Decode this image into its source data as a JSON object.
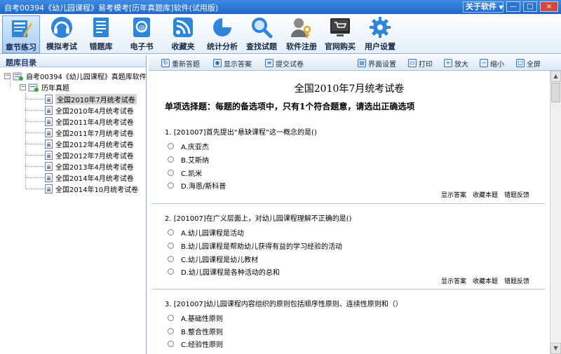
{
  "window": {
    "title": "自考00394《幼儿园课程》易考模考[历年真题库]软件(试用版)",
    "about_label": "关于软件",
    "min": "—",
    "restore": "□",
    "close": "×"
  },
  "toolbar": [
    {
      "label": "章节练习",
      "icon": "pencil-book-icon"
    },
    {
      "label": "模拟考试",
      "icon": "headset-icon"
    },
    {
      "label": "错题库",
      "icon": "notebook-icon"
    },
    {
      "label": "电子书",
      "icon": "ebook-icon"
    },
    {
      "label": "收藏夹",
      "icon": "rss-icon"
    },
    {
      "label": "统计分析",
      "icon": "pie-chart-icon"
    },
    {
      "label": "查找试题",
      "icon": "magnifier-icon"
    },
    {
      "label": "软件注册",
      "icon": "user-key-icon"
    },
    {
      "label": "官网购买",
      "icon": "cart-icon"
    },
    {
      "label": "用户设置",
      "icon": "gear-icon"
    }
  ],
  "sidebar": {
    "header": "题库目录",
    "root": "自考00394《幼儿园课程》真题库软件",
    "folder": "历年真题",
    "items": [
      "全国2010年7月统考试卷",
      "全国2010年4月统考试卷",
      "全国2011年4月统考试卷",
      "全国2011年7月统考试卷",
      "全国2012年4月统考试卷",
      "全国2012年7月统考试卷",
      "全国2013年4月统考试卷",
      "全国2014年4月统考试卷",
      "全国2014年10月统考试卷"
    ]
  },
  "rtoolbar": {
    "reset": "重新答题",
    "show": "显示答案",
    "submit": "提交试卷",
    "interface": "界面设置",
    "print": "打印",
    "zoom_in": "放大",
    "zoom_out": "缩小",
    "fullscreen": "全屏"
  },
  "paper": {
    "title": "全国2010年7月统考试卷",
    "section": "单项选择题：每题的备选项中，只有1个符合题意，请选出正确选项"
  },
  "actions": {
    "show": "显示答案",
    "fav": "收藏本题",
    "report": "错题反馈"
  },
  "questions": [
    {
      "text": "1. [201007]首先提出“悬缺课程”这一概念的是()",
      "options": [
        "A.庆亚杰",
        "B.艾斯纳",
        "C.凯米",
        "D.海恩/斯科普"
      ]
    },
    {
      "text": "2. [201007]在广义层面上，对幼儿园课程理解不正确的是()",
      "options": [
        "A.幼儿园课程是活动",
        "B.幼儿园课程是帮助幼儿获得有益的学习经验的活动",
        "C.幼儿园课程是幼儿教材",
        "D.幼儿园课程是各种活动的总和"
      ]
    },
    {
      "text": "3. [201007]幼儿园课程内容组织的原则包括顺序性原则、连续性原则和（）",
      "options": [
        "A.基础性原则",
        "B.整合性原则",
        "C.经验性原则"
      ]
    }
  ],
  "colors": {
    "accent": "#1f66c8",
    "toolbar_bg": "#e4eef9"
  }
}
